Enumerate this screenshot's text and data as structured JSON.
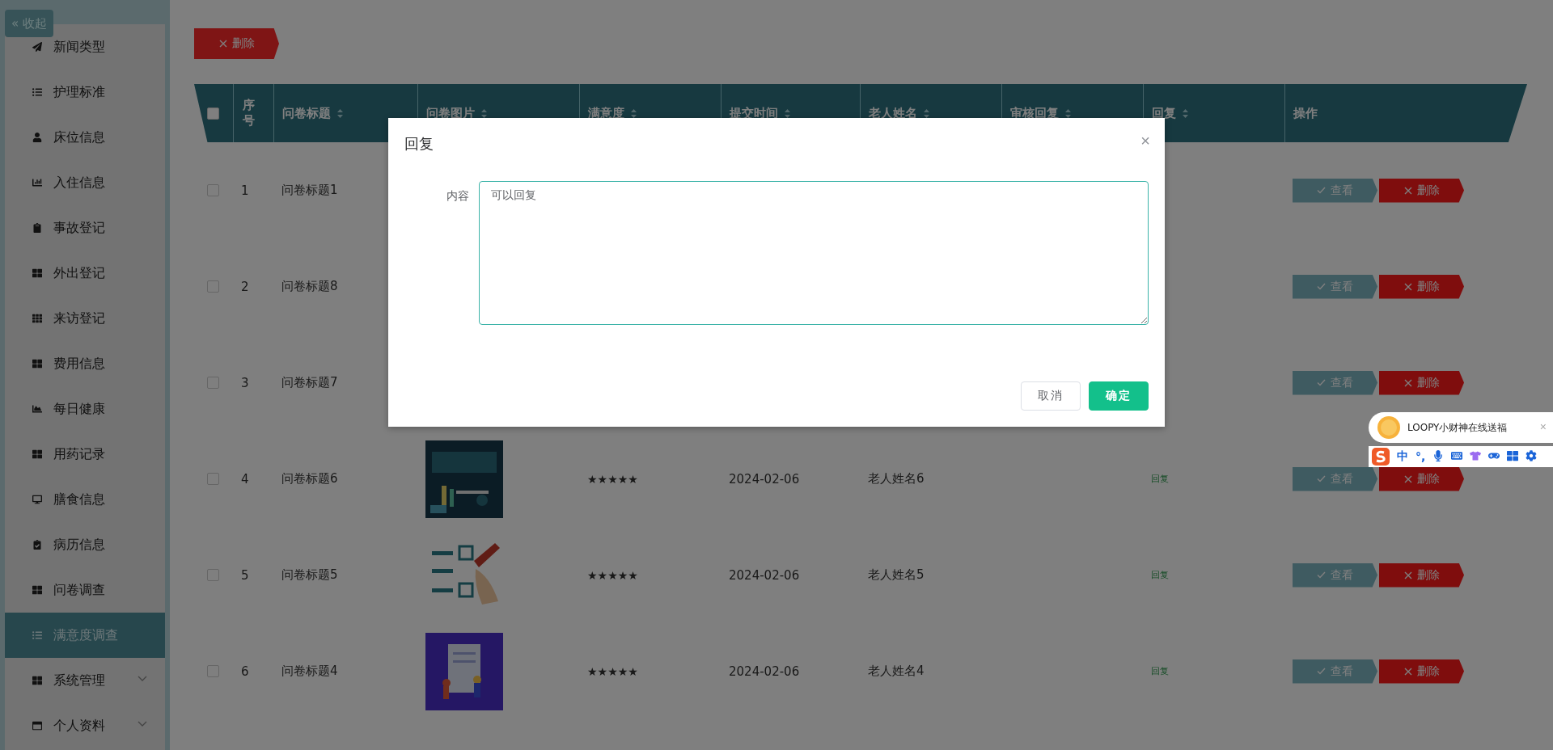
{
  "collapse_button": {
    "icon": "«",
    "label": "收起"
  },
  "sidebar": {
    "items": [
      {
        "label": "新闻类型",
        "selected": false
      },
      {
        "label": "护理标准",
        "selected": false
      },
      {
        "label": "床位信息",
        "selected": false
      },
      {
        "label": "入住信息",
        "selected": false
      },
      {
        "label": "事故登记",
        "selected": false
      },
      {
        "label": "外出登记",
        "selected": false
      },
      {
        "label": "来访登记",
        "selected": false
      },
      {
        "label": "费用信息",
        "selected": false
      },
      {
        "label": "每日健康",
        "selected": false
      },
      {
        "label": "用药记录",
        "selected": false
      },
      {
        "label": "膳食信息",
        "selected": false
      },
      {
        "label": "病历信息",
        "selected": false
      },
      {
        "label": "问卷调查",
        "selected": false
      },
      {
        "label": "满意度调查",
        "selected": true
      },
      {
        "label": "系统管理",
        "selected": false,
        "expanded": false
      },
      {
        "label": "个人资料",
        "selected": false,
        "expanded": false
      }
    ]
  },
  "toolbar": {
    "delete_button": "删除"
  },
  "table": {
    "select_all": {
      "checked": false
    },
    "columns": [
      "序号",
      "问卷标题",
      "问卷图片",
      "满意度",
      "提交时间",
      "老人姓名",
      "审核回复",
      "回复",
      "操作"
    ],
    "rows": [
      {
        "number": "1",
        "title": "问卷标题1",
        "checked": false,
        "actions": [
          "查看",
          "删除"
        ]
      },
      {
        "number": "2",
        "title": "问卷标题8",
        "checked": false,
        "actions": [
          "查看",
          "删除"
        ]
      },
      {
        "number": "3",
        "title": "问卷标题7",
        "checked": false,
        "actions": [
          "查看",
          "删除"
        ]
      },
      {
        "number": "4",
        "title": "问卷标题6",
        "checked": false,
        "stars": 5,
        "date": "2024-02-06",
        "name": "老人姓名6",
        "reply": "回复",
        "actions": [
          "查看",
          "删除"
        ]
      },
      {
        "number": "5",
        "title": "问卷标题5",
        "checked": false,
        "stars": 5,
        "date": "2024-02-06",
        "name": "老人姓名5",
        "reply": "回复",
        "actions": [
          "查看",
          "删除"
        ]
      },
      {
        "number": "6",
        "title": "问卷标题4",
        "checked": false,
        "stars": 5,
        "date": "2024-02-06",
        "name": "老人姓名4",
        "reply": "回复",
        "actions": [
          "查看",
          "删除"
        ]
      }
    ]
  },
  "dialog": {
    "title": "回复",
    "close": "×",
    "field_label": "内容",
    "field_value": "可以回复",
    "buttons": [
      {
        "label": "取消",
        "kind": "default"
      },
      {
        "label": "确定",
        "kind": "primary"
      }
    ]
  },
  "ime_widget": {
    "message": "LOOPY小财神在线送福",
    "close": "×",
    "mode": "中",
    "punctuation": "°,"
  }
}
